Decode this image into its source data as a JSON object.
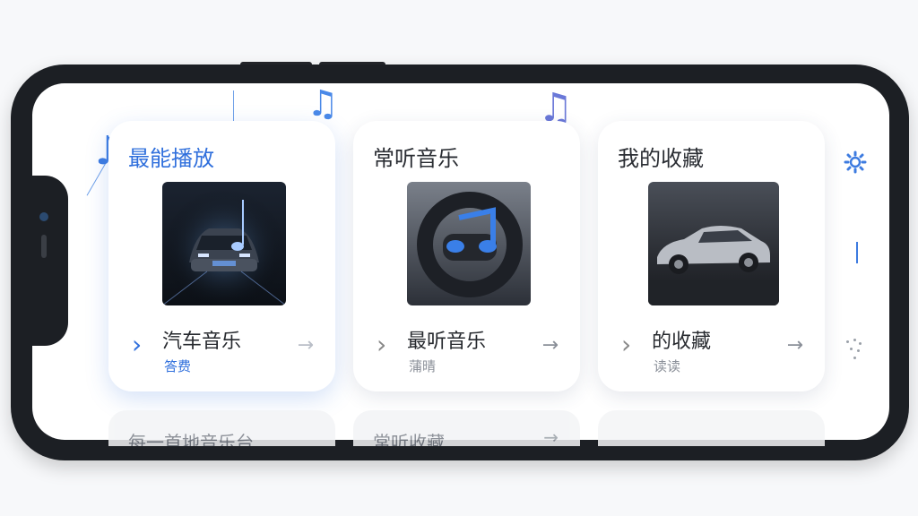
{
  "cards": [
    {
      "title": "最能播放",
      "item_label": "汽车音乐",
      "item_sub": "答费",
      "active": true,
      "cover_desc": "car-with-music-note"
    },
    {
      "title": "常听音乐",
      "item_label": "最听音乐",
      "item_sub": "蒲晴",
      "active": false,
      "cover_desc": "steering-wheel-music-note"
    },
    {
      "title": "我的收藏",
      "item_label": "的收藏",
      "item_sub": "读读",
      "active": false,
      "cover_desc": "silver-sedan"
    }
  ],
  "second_row": [
    {
      "title": "每一首地音乐台"
    },
    {
      "title": "常听收藏"
    },
    {
      "title": ""
    }
  ],
  "icons": {
    "settings": "gear-icon",
    "music_note": "music-note-icon",
    "chevron": "chevron-right-icon",
    "arrow": "arrow-right-icon"
  },
  "colors": {
    "accent": "#2f6fdc",
    "frame": "#1c1f24",
    "background": "#f7f8fa"
  }
}
